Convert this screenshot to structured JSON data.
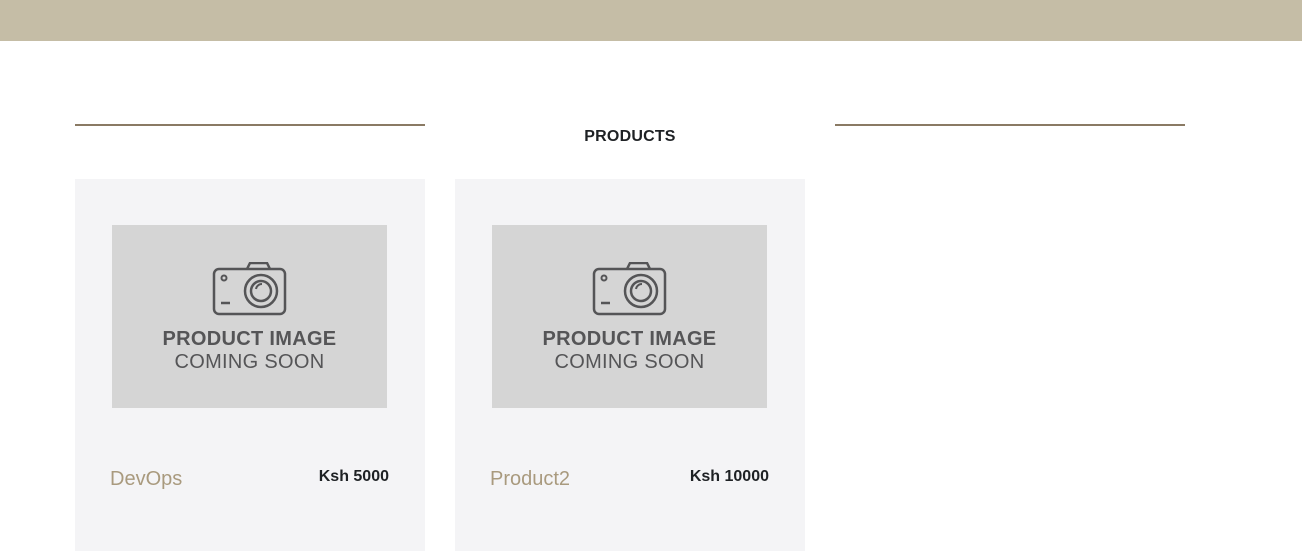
{
  "section": {
    "title": "PRODUCTS"
  },
  "products": [
    {
      "name": "DevOps",
      "price": "Ksh 5000",
      "image_text_line1": "PRODUCT IMAGE",
      "image_text_line2": "COMING SOON"
    },
    {
      "name": "Product2",
      "price": "Ksh 10000",
      "image_text_line1": "PRODUCT IMAGE",
      "image_text_line2": "COMING SOON"
    }
  ],
  "colors": {
    "topbar": "#c5bda6",
    "rule": "#8a7a64",
    "card_bg": "#f4f4f6",
    "placeholder_bg": "#d5d5d5",
    "product_name": "#a99a7e",
    "text_dark": "#1e2124"
  },
  "icons": {
    "placeholder": "camera-icon"
  }
}
